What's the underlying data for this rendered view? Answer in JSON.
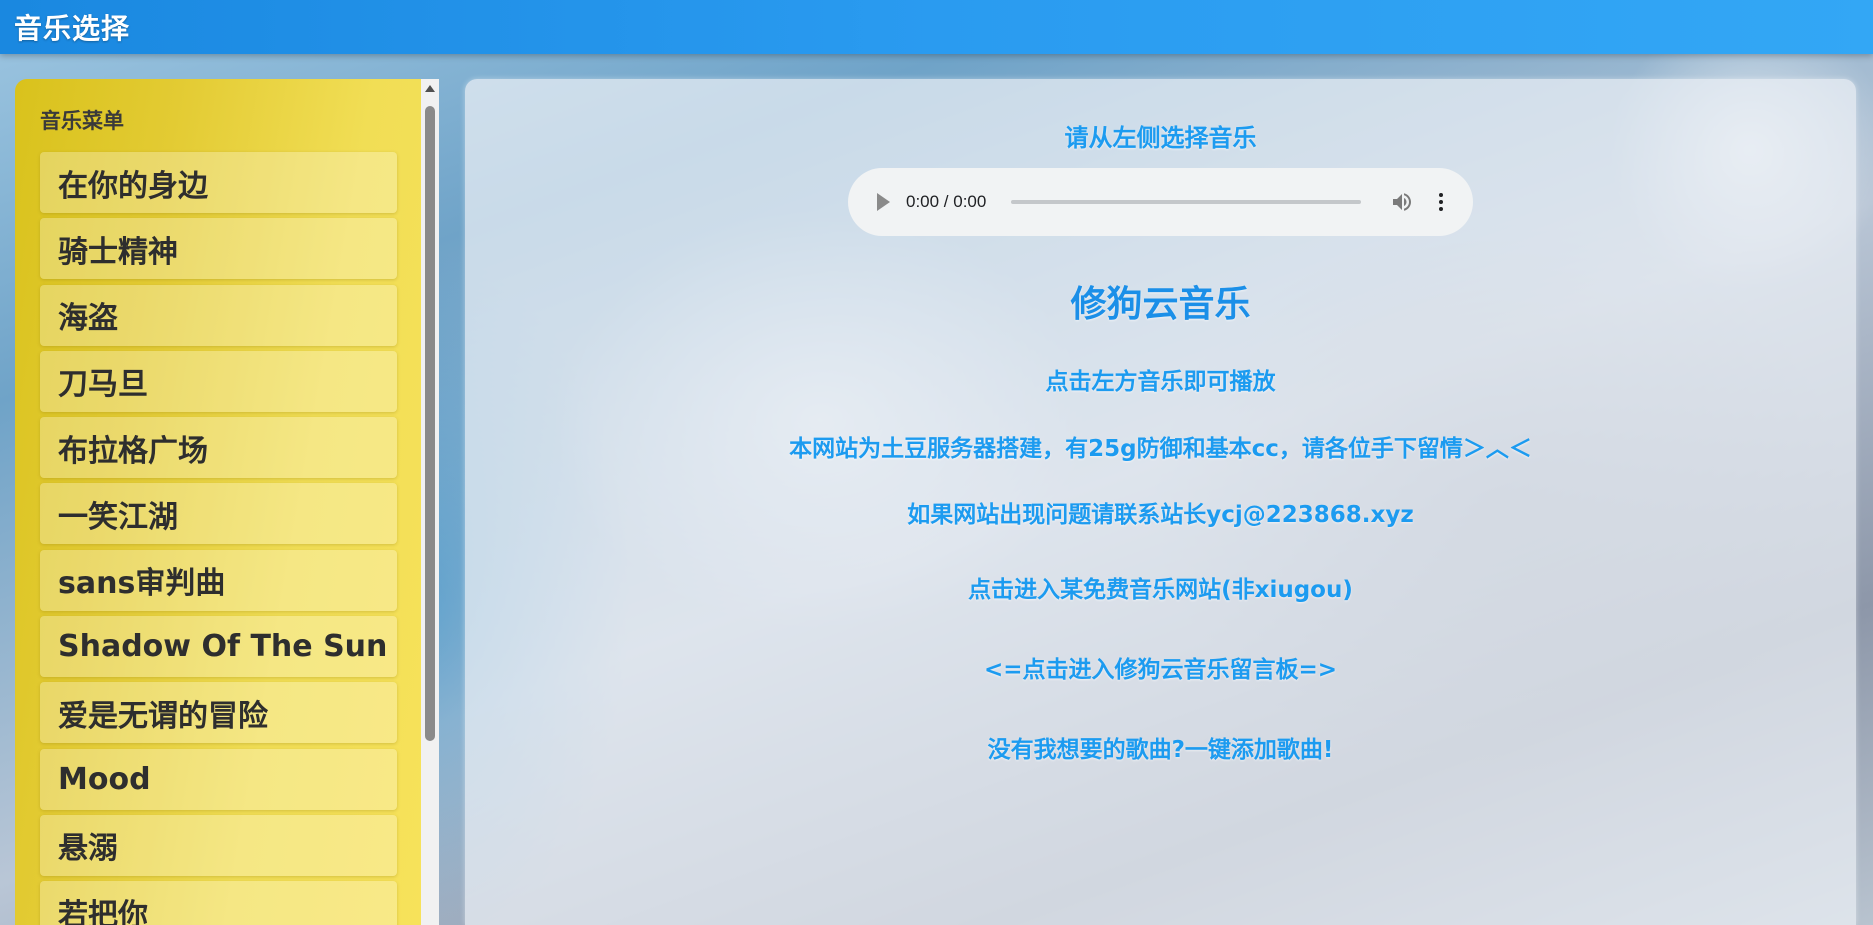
{
  "header": {
    "title": "音乐选择"
  },
  "sidebar": {
    "menu_title": "音乐菜单",
    "items": [
      "在你的身边",
      "骑士精神",
      "海盗",
      "刀马旦",
      "布拉格广场",
      "一笑江湖",
      "sans审判曲",
      "Shadow Of The Sun",
      "爱是无谓的冒险",
      "Mood",
      "悬溺",
      "若把你"
    ]
  },
  "main": {
    "prompt": "请从左侧选择音乐",
    "player": {
      "time": "0:00 / 0:00"
    },
    "brand": "修狗云音乐",
    "hint": "点击左方音乐即可播放",
    "notice": "本网站为土豆服务器搭建，有25g防御和基本cc，请各位手下留情＞︿＜",
    "contact": "如果网站出现问题请联系站长ycj@223868.xyz",
    "link_free_music": "点击进入某免费音乐网站(非xiugou)",
    "link_board": "<=点击进入修狗云音乐留言板=>",
    "link_add_song": "没有我想要的歌曲?一键添加歌曲!"
  },
  "colors": {
    "header_bg": "#2a9bf0",
    "accent_text": "#1c9bf0",
    "sidebar_bg": "#e8d240"
  },
  "icons": [
    "play-icon",
    "volume-icon",
    "more-options-icon"
  ]
}
